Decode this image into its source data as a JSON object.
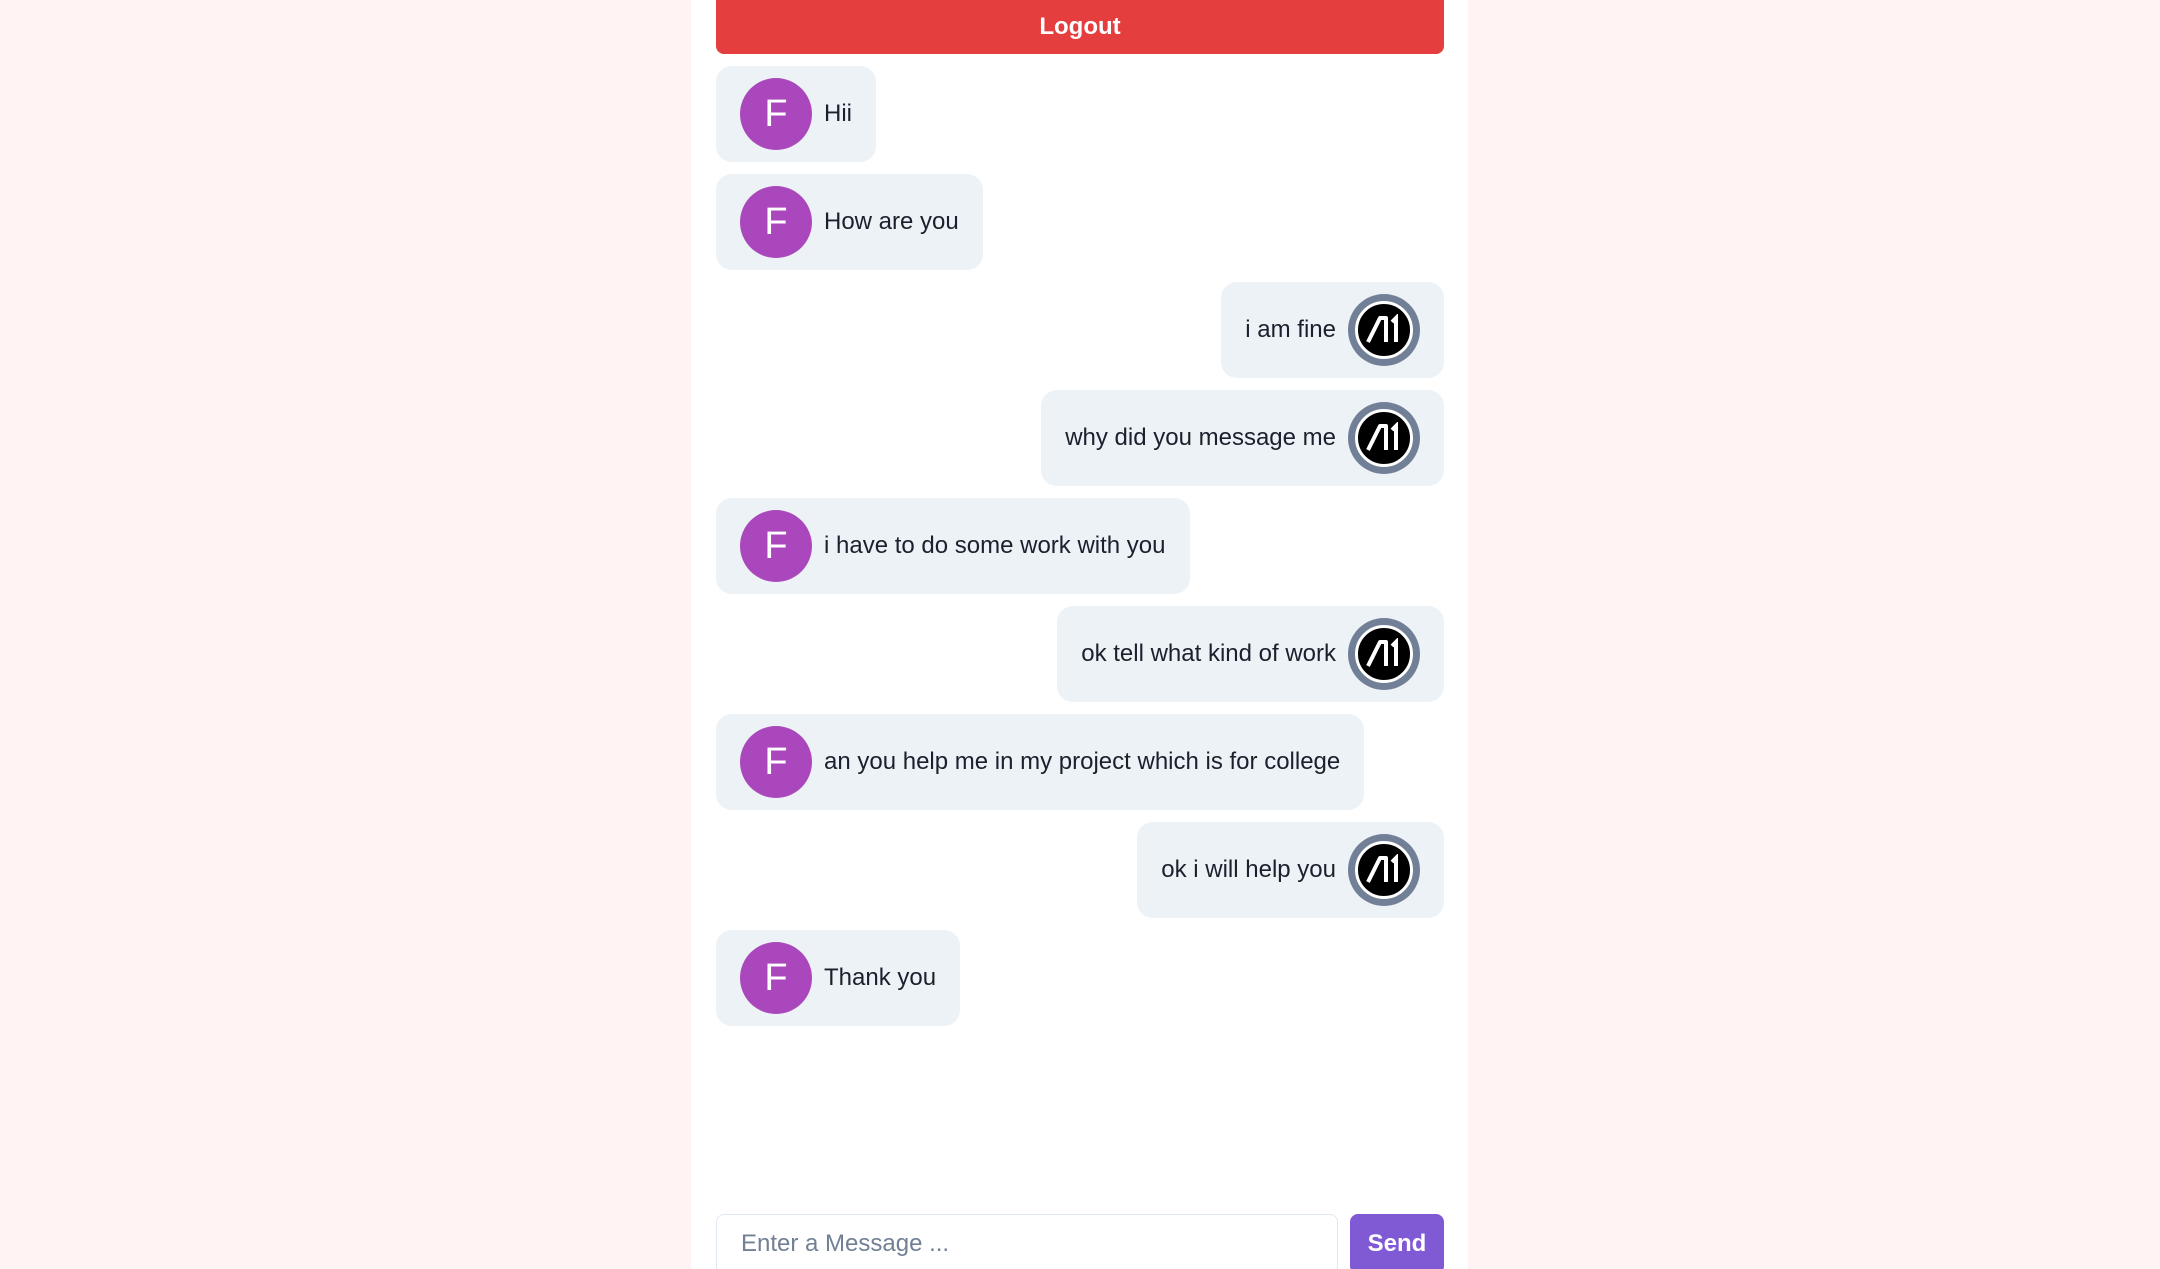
{
  "header": {
    "logout_label": "Logout"
  },
  "conversation": {
    "messages": [
      {
        "sender": "other",
        "avatar_letter": "F",
        "text": "Hii"
      },
      {
        "sender": "other",
        "avatar_letter": "F",
        "text": "How are you"
      },
      {
        "sender": "me",
        "avatar_icon": "ai-logo-icon",
        "text": "i am fine"
      },
      {
        "sender": "me",
        "avatar_icon": "ai-logo-icon",
        "text": "why did you message me"
      },
      {
        "sender": "other",
        "avatar_letter": "F",
        "text": "i have to do some work with you"
      },
      {
        "sender": "me",
        "avatar_icon": "ai-logo-icon",
        "text": "ok tell what kind of work"
      },
      {
        "sender": "other",
        "avatar_letter": "F",
        "text": "an you help me in my project which is for college"
      },
      {
        "sender": "me",
        "avatar_icon": "ai-logo-icon",
        "text": "ok i will help you"
      },
      {
        "sender": "other",
        "avatar_letter": "F",
        "text": "Thank you"
      }
    ]
  },
  "composer": {
    "placeholder": "Enter a Message ...",
    "value": "",
    "send_label": "Send"
  },
  "colors": {
    "page_background": "#fff4f3",
    "logout": "#e53e3e",
    "send": "#805ad5",
    "avatar_f": "#ab47bc",
    "bubble": "#edf2f7",
    "ai_avatar_ring": "#718096"
  }
}
